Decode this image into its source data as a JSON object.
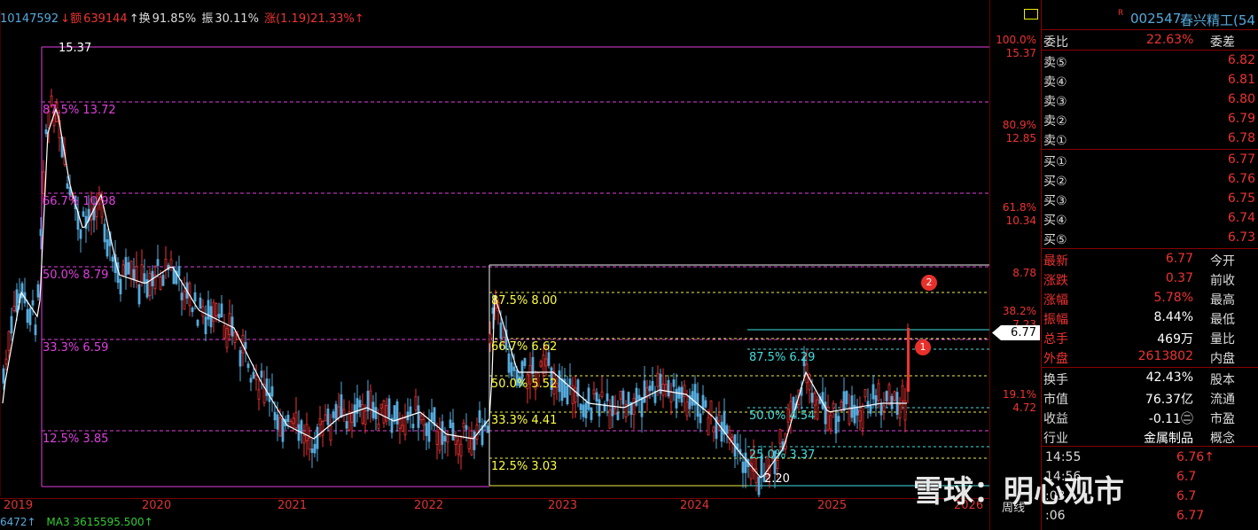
{
  "header": {
    "vol": "10147592",
    "amt_label": "↓额",
    "amt": "639144",
    "hs_label": "↑换",
    "hs": "91.85%",
    "zf_label": "振",
    "zf": "30.11%",
    "zd": "涨(1.19)21.33%↑"
  },
  "years": [
    "2019",
    "2020",
    "2021",
    "2022",
    "2023",
    "2024",
    "2025",
    "2026"
  ],
  "period_label": "周线",
  "ma_left": "6472↑",
  "ma3": "MA3 3615595.500↑",
  "fib_left": [
    {
      "label": "15.37",
      "color": "#fff"
    },
    {
      "label": "87.5% 13.72",
      "color": "#e040e0"
    },
    {
      "label": "66.7% 10.98",
      "color": "#e040e0"
    },
    {
      "label": "50.0% 8.79",
      "color": "#e040e0"
    },
    {
      "label": "33.3% 6.59",
      "color": "#e040e0"
    },
    {
      "label": "12.5% 3.85",
      "color": "#e040e0"
    }
  ],
  "fib_mid": [
    {
      "label": "87.5% 8.00",
      "color": "#ffff40"
    },
    {
      "label": "66.7% 6.62",
      "color": "#ffff40"
    },
    {
      "label": "50.0% 5.52",
      "color": "#ffff40"
    },
    {
      "label": "33.3% 4.41",
      "color": "#ffff40"
    },
    {
      "label": "12.5% 3.03",
      "color": "#ffff40"
    }
  ],
  "fib_right": [
    {
      "label": "87.5% 6.29",
      "color": "#40e0e0"
    },
    {
      "label": "50.0% 4.54",
      "color": "#40e0e0"
    },
    {
      "label": "25.0% 3.37",
      "color": "#40e0e0"
    },
    {
      "label": "2.20",
      "color": "#fff"
    }
  ],
  "axis": {
    "p100": "100.0%",
    "v1537": "15.37",
    "p809": "80.9%",
    "v1285": "12.85",
    "p618": "61.8%",
    "v1034": "10.34",
    "v878": "8.78",
    "p382": "38.2%",
    "v723": "7.23",
    "p191": "19.1%",
    "v472": "4.72",
    "last": "6.77"
  },
  "markers": [
    "1",
    "2"
  ],
  "panel": {
    "code": "002547",
    "name": "春兴精工(54",
    "wb_label": "委比",
    "wb_val": "22.63%",
    "wc_label": "委差",
    "sell": [
      {
        "label": "卖⑤",
        "price": "6.82"
      },
      {
        "label": "卖④",
        "price": "6.81"
      },
      {
        "label": "卖③",
        "price": "6.80"
      },
      {
        "label": "卖②",
        "price": "6.79"
      },
      {
        "label": "卖①",
        "price": "6.78"
      }
    ],
    "buy": [
      {
        "label": "买①",
        "price": "6.77"
      },
      {
        "label": "买②",
        "price": "6.76"
      },
      {
        "label": "买③",
        "price": "6.75"
      },
      {
        "label": "买④",
        "price": "6.74"
      },
      {
        "label": "买⑤",
        "price": "6.73"
      }
    ],
    "stats": [
      {
        "l": "最新",
        "v": "6.77",
        "r": "今开",
        "c": "#e33"
      },
      {
        "l": "涨跌",
        "v": "0.37",
        "r": "前收",
        "c": "#e33"
      },
      {
        "l": "涨幅",
        "v": "5.78%",
        "r": "最高",
        "c": "#e33"
      },
      {
        "l": "振幅",
        "v": "8.44%",
        "r": "最低",
        "c": "#fff"
      },
      {
        "l": "总手",
        "v": "469万",
        "r": "量比",
        "c": "#fff"
      },
      {
        "l": "外盘",
        "v": "2613802",
        "r": "内盘",
        "c": "#e33"
      }
    ],
    "stats2": [
      {
        "l": "换手",
        "v": "42.43%",
        "r": "股本",
        "c": "#fff"
      },
      {
        "l": "市值",
        "v": "76.37亿",
        "r": "流通",
        "c": "#fff"
      },
      {
        "l": "收益",
        "v": "-0.11㊁",
        "r": "市盈",
        "c": "#fff"
      },
      {
        "l": "行业",
        "v": "金属制品",
        "r": "概念",
        "c": "#fff"
      }
    ],
    "ticks": [
      {
        "t": "14:55",
        "p": "6.76↑"
      },
      {
        "t": "14:56",
        "p": "6.7"
      },
      {
        "t": ":03",
        "p": "6.7"
      },
      {
        "t": ":06",
        "p": "6.77"
      }
    ]
  },
  "watermark": "雪球：明心观市"
}
